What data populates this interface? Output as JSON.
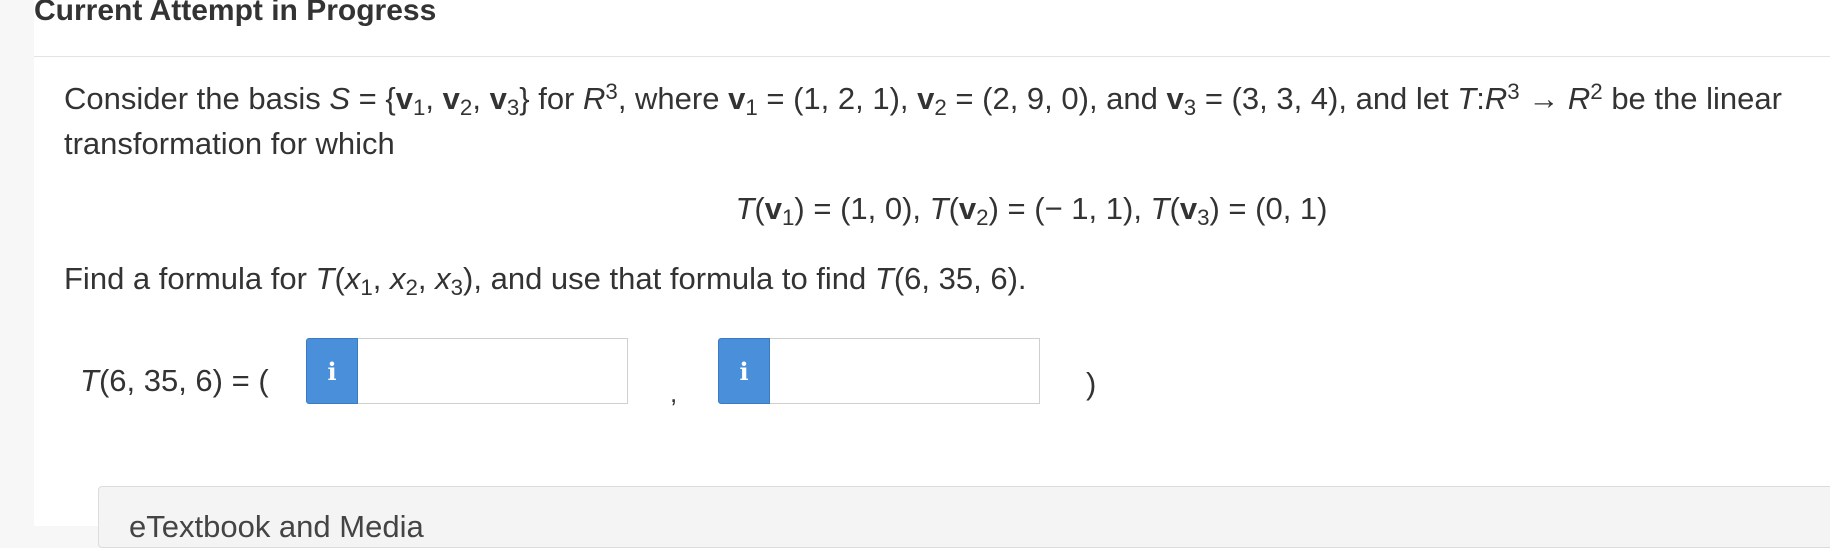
{
  "header": {
    "title": "Current Attempt in Progress"
  },
  "problem": {
    "intro": {
      "p1": "Consider the basis ",
      "S": "S",
      "p2": " = {",
      "v": "v",
      "sub1": "1",
      "c1": ", ",
      "sub2": "2",
      "c2": ", ",
      "sub3": "3",
      "p3": "} for ",
      "R": "R",
      "sup3": "3",
      "p4": ", where ",
      "p5": " = (1, 2, 1), ",
      "p6": " = (2, 9, 0), and ",
      "p7": " = (3, 3, 4), and let ",
      "T": "T",
      "p8": ":",
      "p9": " → ",
      "sup2": "2",
      "p10": " be the linear transformation for which"
    },
    "equation": {
      "T": "T",
      "open": "(",
      "v": "v",
      "sub1": "1",
      "r1": ") = (1, 0), ",
      "sub2": "2",
      "r2": ") = (− 1, 1), ",
      "sub3": "3",
      "r3": ") = (0, 1)"
    },
    "find": {
      "p1": "Find a formula for ",
      "T": "T",
      "open": "(",
      "x": "x",
      "sub1": "1",
      "c": ", ",
      "sub2": "2",
      "sub3": "3",
      "p2": "), and use that formula to find ",
      "p3": "(6, 35, 6)."
    }
  },
  "answer": {
    "T": "T",
    "lead": "(6, 35, 6) = (",
    "info_glyph": "i",
    "input1_value": "",
    "input2_value": "",
    "comma": ",",
    "close": ")"
  },
  "media": {
    "label": "eTextbook and Media"
  },
  "colors": {
    "info_button": "#4a8fd9",
    "text": "#333333"
  }
}
